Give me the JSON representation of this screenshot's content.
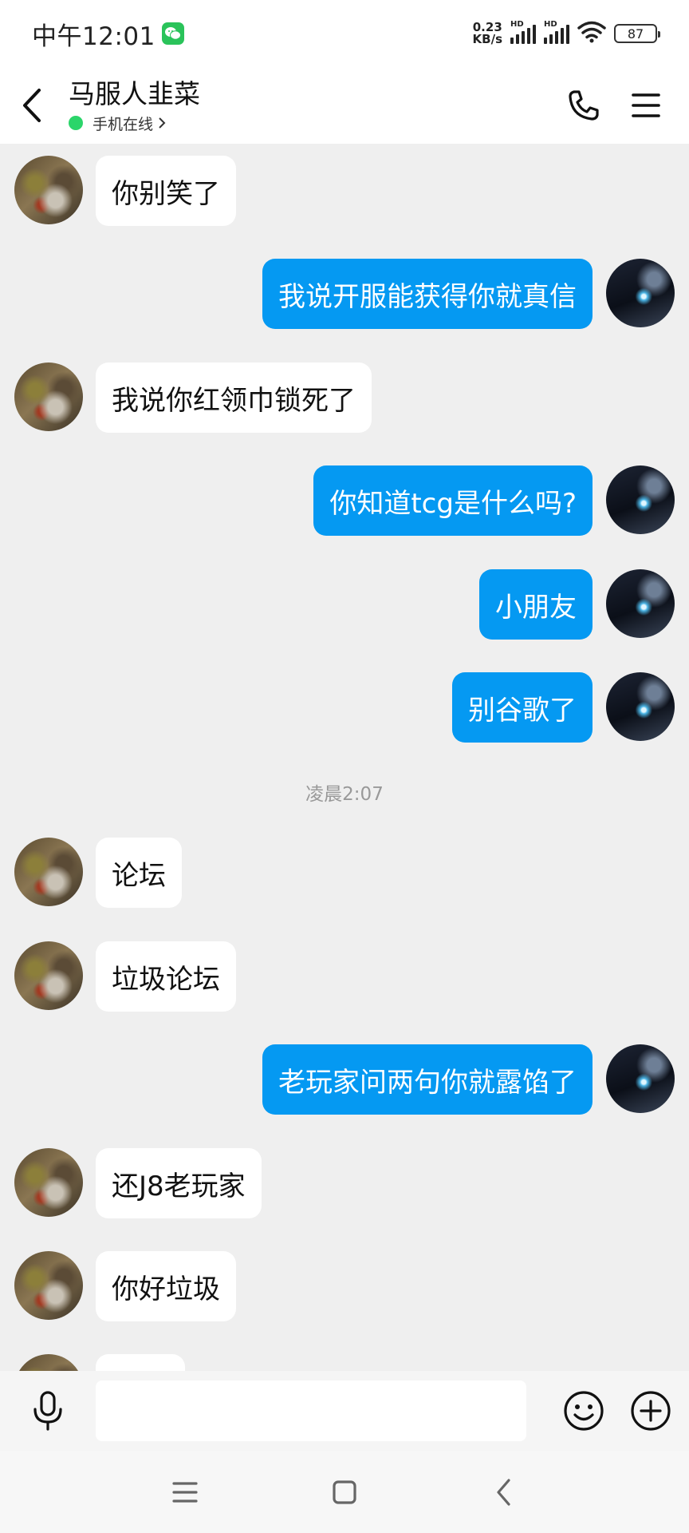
{
  "status_bar": {
    "time": "中午12:01",
    "net_speed_value": "0.23",
    "net_speed_unit": "KB/s",
    "signal_label_1": "HD",
    "signal_label_2": "HD",
    "battery": "87"
  },
  "header": {
    "contact_name": "马服人韭菜",
    "online_status": "手机在线",
    "online_color": "#2bd56a"
  },
  "colors": {
    "sent_bubble": "#0599f2",
    "received_bubble": "#ffffff",
    "chat_background": "#efefef"
  },
  "messages": [
    {
      "side": "left",
      "text": "你别笑了"
    },
    {
      "side": "right",
      "text": "我说开服能获得你就真信"
    },
    {
      "side": "left",
      "text": "我说你红领巾锁死了"
    },
    {
      "side": "right",
      "text": "你知道tcg是什么吗?"
    },
    {
      "side": "right",
      "text": "小朋友"
    },
    {
      "side": "right",
      "text": "别谷歌了"
    },
    {
      "side": "left",
      "text": "论坛"
    },
    {
      "side": "left",
      "text": "垃圾论坛"
    },
    {
      "side": "right",
      "text": "老玩家问两句你就露馅了"
    },
    {
      "side": "left",
      "text": "还J8老玩家"
    },
    {
      "side": "left",
      "text": "你好垃圾"
    }
  ],
  "timestamp": "凌晨2:07",
  "input": {
    "value": "",
    "placeholder": ""
  },
  "icons": {
    "back": "back-arrow-icon",
    "call": "phone-icon",
    "menu": "menu-icon",
    "voice": "microphone-icon",
    "emoji": "emoji-icon",
    "more": "plus-icon",
    "nav_menu": "nav-menu-icon",
    "nav_home": "nav-home-icon",
    "nav_back": "nav-back-icon"
  }
}
